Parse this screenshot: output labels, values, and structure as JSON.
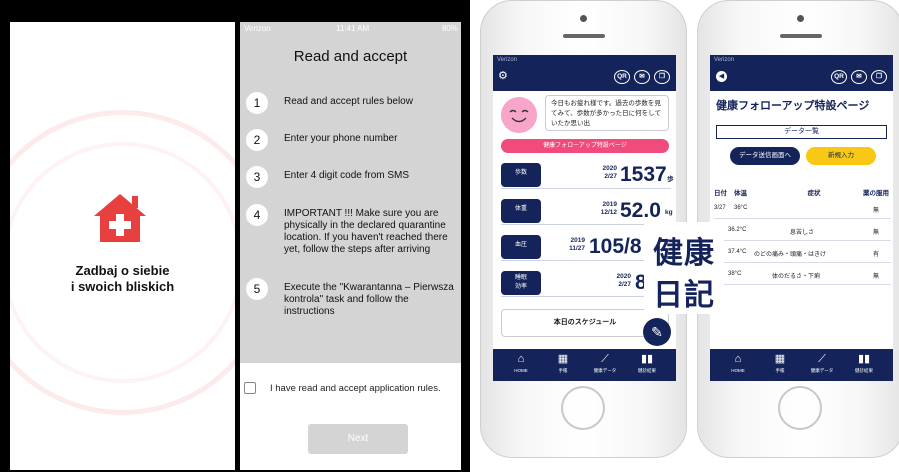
{
  "splash": {
    "line1": "Zadbaj o siebie",
    "line2": "i swoich bliskich"
  },
  "rules_screen": {
    "status": {
      "carrier": "Verizon",
      "time": "11:41 AM",
      "battery": "80%"
    },
    "title": "Read and accept",
    "steps": [
      {
        "num": "1",
        "text": "Read and accept rules below"
      },
      {
        "num": "2",
        "text": "Enter your phone number"
      },
      {
        "num": "3",
        "text": "Enter 4 digit code from SMS"
      },
      {
        "num": "4",
        "text": "IMPORTANT !!! Make sure you are\nphysically in the declared quarantine\nlocation. If you haven't reached there\nyet, follow the steps after arriving"
      },
      {
        "num": "5",
        "text": "Execute the \"Kwarantanna – Pierwsza\nkontrola\" task and follow the\ninstructions"
      }
    ],
    "accept_label": "I have read and accept application rules.",
    "next_label": "Next"
  },
  "phone1": {
    "status": "Verizon",
    "header_icons": [
      "QR"
    ],
    "message": "今日もお疲れ様です。過去の歩数を見てみて、歩数が多かった日に何をしていたか思い出",
    "pink_button": "健康フォローアップ特設ページ",
    "metrics": [
      {
        "label": "歩数",
        "date": "2020\n2/27",
        "value": "1537",
        "unit": "歩"
      },
      {
        "label": "体重",
        "date": "2019\n12/12",
        "value": "52.0",
        "unit": "kg"
      },
      {
        "label": "血圧",
        "date": "2019\n11/27",
        "value": "105/8",
        "unit": ""
      },
      {
        "label": "睡眠\n効率",
        "date": "2020\n2/27",
        "value": "8",
        "unit": ""
      }
    ],
    "schedule": "本日のスケジュール",
    "tabs": [
      {
        "icon": "⌂",
        "label": "HOME"
      },
      {
        "icon": "▦",
        "label": "手帳"
      },
      {
        "icon": "⟋",
        "label": "健康データ"
      },
      {
        "icon": "▮▮",
        "label": "健診結果"
      }
    ]
  },
  "phone2": {
    "status": "Verizon",
    "header_icons": [
      "QR"
    ],
    "page_title": "健康フォローアップ特設ページ",
    "section": "データ一覧",
    "send_button": "データ送信画面へ",
    "new_button": "新規入力",
    "columns": [
      "日付",
      "体温",
      "症状",
      "薬の服用"
    ],
    "rows": [
      {
        "date": "3/27",
        "temp": "36°C",
        "symptom": "",
        "med": "無"
      },
      {
        "date": "",
        "temp": "36.2°C",
        "symptom": "息苦しさ",
        "med": "無"
      },
      {
        "date": "",
        "temp": "37.4°C",
        "symptom": "のどの痛み・頭痛・はきけ",
        "med": "有"
      },
      {
        "date": "",
        "temp": "38°C",
        "symptom": "体のだるさ・下痢",
        "med": "無"
      }
    ],
    "tabs": [
      {
        "icon": "⌂",
        "label": "HOME"
      },
      {
        "icon": "▦",
        "label": "手帳"
      },
      {
        "icon": "⟋",
        "label": "健康データ"
      },
      {
        "icon": "▮▮",
        "label": "健診結果"
      }
    ]
  },
  "logo": {
    "line1": "健康",
    "line2": "日記"
  },
  "colors": {
    "navy": "#14245b",
    "pink": "#f04b7c",
    "yellow": "#f9c814",
    "brand_red": "#e8403f"
  }
}
